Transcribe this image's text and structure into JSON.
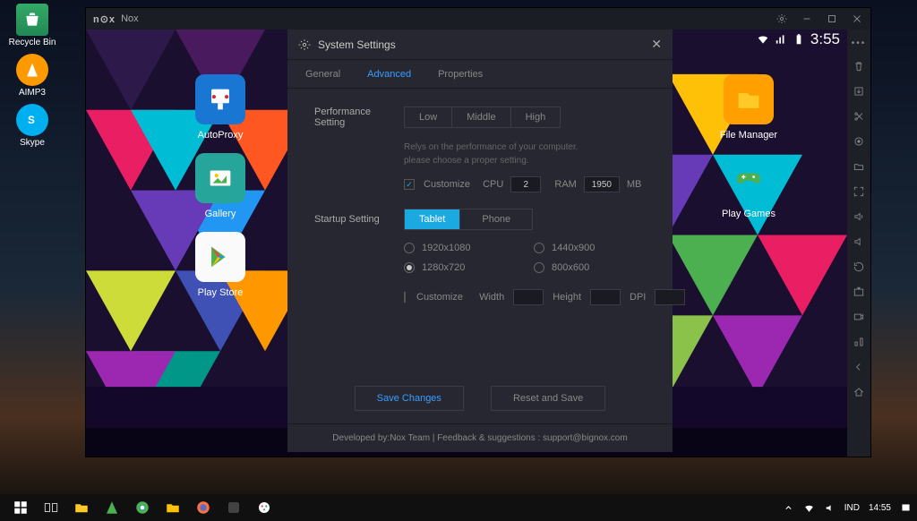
{
  "desktop": {
    "icons": [
      {
        "label": "Recycle Bin"
      },
      {
        "label": "AIMP3"
      },
      {
        "label": "Skype"
      }
    ]
  },
  "nox": {
    "title": "Nox",
    "statusbar_time": "3:55",
    "home": {
      "file_manager": "File Manager",
      "play_games": "Play Games",
      "autoproxy": "AutoProxy",
      "gallery": "Gallery",
      "play_store": "Play Store"
    }
  },
  "settings": {
    "title": "System Settings",
    "tabs": {
      "general": "General",
      "advanced": "Advanced",
      "properties": "Properties"
    },
    "perf_label": "Performance Setting",
    "perf_low": "Low",
    "perf_mid": "Middle",
    "perf_high": "High",
    "hint1": "Relys on the performance of your computer.",
    "hint2": "please choose a proper setting.",
    "customize": "Customize",
    "cpu": "CPU",
    "cpu_val": "2",
    "ram": "RAM",
    "ram_val": "1950",
    "mb": "MB",
    "startup_label": "Startup Setting",
    "tablet": "Tablet",
    "phone": "Phone",
    "r1": "1920x1080",
    "r2": "1440x900",
    "r3": "1280x720",
    "r4": "800x600",
    "width": "Width",
    "height": "Height",
    "dpi": "DPI",
    "save": "Save Changes",
    "reset": "Reset and Save",
    "footer": "Developed by:Nox Team     |     Feedback & suggestions : support@bignox.com"
  },
  "taskbar": {
    "lang": "IND",
    "time": "14:55"
  }
}
